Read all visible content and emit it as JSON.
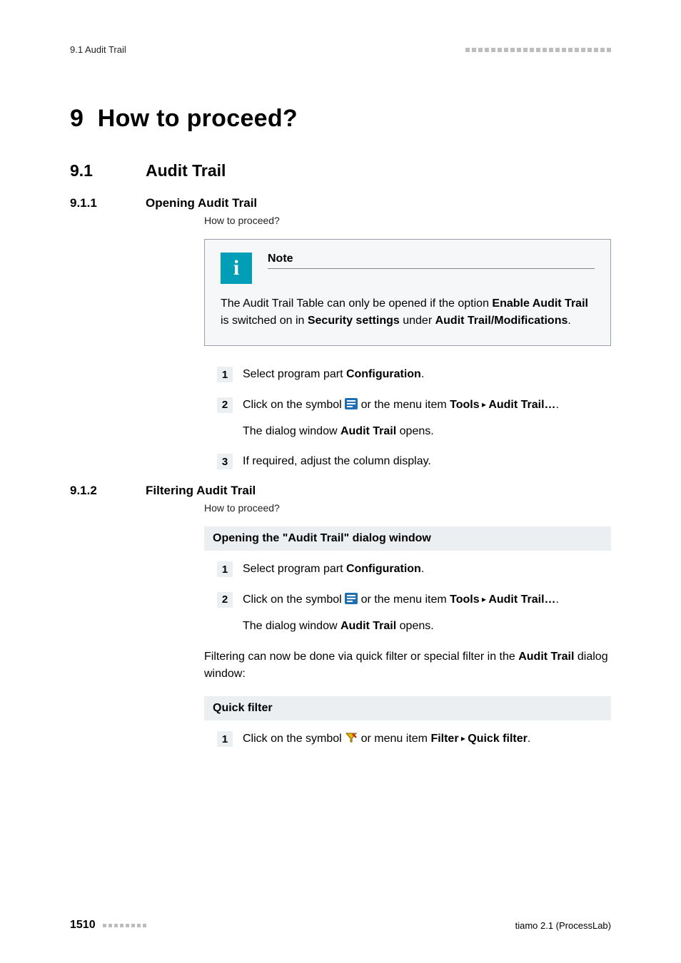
{
  "header": {
    "left": "9.1 Audit Trail"
  },
  "chapter": {
    "number": "9",
    "title": "How to proceed?"
  },
  "section": {
    "number": "9.1",
    "title": "Audit Trail"
  },
  "sub1": {
    "number": "9.1.1",
    "title": "Opening Audit Trail",
    "howto": "How to proceed?",
    "note_title": "Note",
    "note_t1": "The Audit Trail Table can only be opened if the option ",
    "note_b1": "Enable Audit Trail",
    "note_t2": " is switched on in ",
    "note_b2": "Security settings",
    "note_t3": " under ",
    "note_b3": "Audit Trail/Modifications",
    "note_t4": ".",
    "steps": {
      "s1": {
        "n": "1",
        "t1": "Select program part ",
        "b1": "Configuration",
        "t2": "."
      },
      "s2": {
        "n": "2",
        "t1": "Click on the symbol ",
        "t2": " or the menu item ",
        "b1": "Tools",
        "sep": " ▸ ",
        "b2": "Audit Trail…",
        "t3": ".",
        "p2a": "The dialog window ",
        "p2b": "Audit Trail",
        "p2c": " opens."
      },
      "s3": {
        "n": "3",
        "t1": "If required, adjust the column display."
      }
    }
  },
  "sub2": {
    "number": "9.1.2",
    "title": "Filtering Audit Trail",
    "howto": "How to proceed?",
    "head1": "Opening the \"Audit Trail\" dialog window",
    "steps": {
      "s1": {
        "n": "1",
        "t1": "Select program part ",
        "b1": "Configuration",
        "t2": "."
      },
      "s2": {
        "n": "2",
        "t1": "Click on the symbol ",
        "t2": " or the menu item ",
        "b1": "Tools",
        "sep": " ▸ ",
        "b2": "Audit Trail…",
        "t3": ".",
        "p2a": "The dialog window ",
        "p2b": "Audit Trail",
        "p2c": " opens."
      }
    },
    "mid_t1": "Filtering can now be done via quick filter or special filter in the ",
    "mid_b1": "Audit Trail",
    "mid_t2": " dialog window:",
    "head2": "Quick filter",
    "qsteps": {
      "s1": {
        "n": "1",
        "t1": "Click on the symbol ",
        "t2": " or menu item ",
        "b1": "Filter",
        "sep": " ▸ ",
        "b2": "Quick filter",
        "t3": "."
      }
    }
  },
  "footer": {
    "page": "1510",
    "product": "tiamo 2.1 (ProcessLab)"
  },
  "icons": {
    "info": "i"
  }
}
